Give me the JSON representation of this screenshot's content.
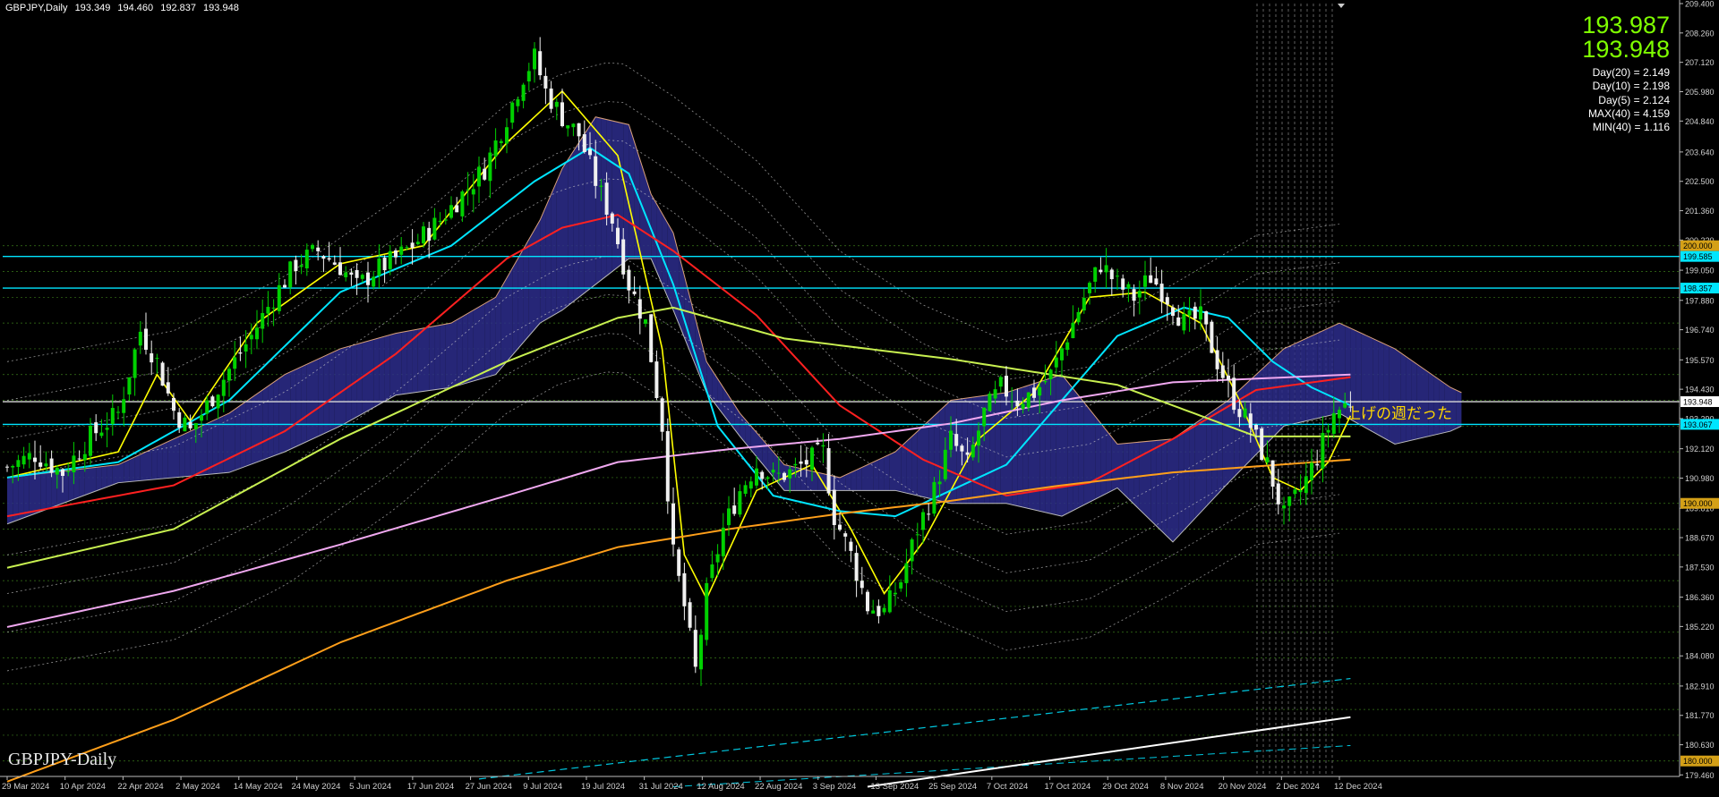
{
  "header": {
    "symbol": "GBPJPY,Daily",
    "open": "193.349",
    "high": "194.460",
    "low": "192.837",
    "close": "193.948"
  },
  "quote": {
    "ask": "193.987",
    "bid": "193.948"
  },
  "stats": [
    "Day(20) = 2.149",
    "Day(10) = 2.198",
    "Day(5) = 2.124",
    "MAX(40) = 4.159",
    "MIN(40) = 1.116"
  ],
  "watermark": "GBPJPY-Daily",
  "annotation": "上げの週だった",
  "colors": {
    "background": "#000000",
    "bull_candle": "#00d000",
    "bear_candle": "#f0f0f0",
    "ma_fast": "#ffff00",
    "ma_mid": "#00e5ff",
    "ma_slow": "#ff2020",
    "ma_long": "#c8f050",
    "ma_200": "#f0a8f0",
    "ma_longest": "#ff9f1a",
    "cloud_blue": "#2d2d8c",
    "cloud_red": "#b0503c",
    "hline_cyan": "#00e5ff",
    "quote_green": "#7fff00"
  },
  "chart_data": {
    "type": "candlestick",
    "symbol": "GBPJPY",
    "timeframe": "Daily",
    "ylim": [
      179.4,
      209.4
    ],
    "y_ticks": [
      "209.400",
      "208.260",
      "207.120",
      "205.980",
      "204.840",
      "203.640",
      "202.500",
      "201.360",
      "200.220",
      "199.050",
      "197.880",
      "196.740",
      "195.570",
      "194.430",
      "193.290",
      "192.120",
      "190.980",
      "189.810",
      "188.670",
      "187.530",
      "186.360",
      "185.220",
      "184.080",
      "182.910",
      "181.770",
      "180.630",
      "179.460"
    ],
    "x_ticks": [
      "29 Mar 2024",
      "10 Apr 2024",
      "22 Apr 2024",
      "2 May 2024",
      "14 May 2024",
      "24 May 2024",
      "5 Jun 2024",
      "17 Jun 2024",
      "27 Jun 2024",
      "9 Jul 2024",
      "19 Jul 2024",
      "31 Jul 2024",
      "12 Aug 2024",
      "22 Aug 2024",
      "3 Sep 2024",
      "13 Sep 2024",
      "25 Sep 2024",
      "7 Oct 2024",
      "17 Oct 2024",
      "29 Oct 2024",
      "8 Nov 2024",
      "20 Nov 2024",
      "2 Dec 2024",
      "12 Dec 2024"
    ],
    "price_labels": [
      {
        "value": 200.0,
        "text": "200.000",
        "color": "#d4a017"
      },
      {
        "value": 199.585,
        "text": "199.585",
        "color": "#00e5ff"
      },
      {
        "value": 198.357,
        "text": "198.357",
        "color": "#00e5ff"
      },
      {
        "value": 193.948,
        "text": "193.948",
        "color": "#ffffff"
      },
      {
        "value": 193.067,
        "text": "193.067",
        "color": "#00e5ff"
      },
      {
        "value": 190.0,
        "text": "190.000",
        "color": "#d4a017"
      },
      {
        "value": 180.0,
        "text": "180.000",
        "color": "#d4a017"
      }
    ],
    "close_path": [
      [
        0,
        191.4
      ],
      [
        5,
        191.9
      ],
      [
        10,
        191.2
      ],
      [
        15,
        192.6
      ],
      [
        20,
        193.5
      ],
      [
        24,
        196.7
      ],
      [
        27,
        195.5
      ],
      [
        30,
        193.6
      ],
      [
        33,
        192.8
      ],
      [
        36,
        193.8
      ],
      [
        40,
        195.2
      ],
      [
        44,
        196.5
      ],
      [
        48,
        198.0
      ],
      [
        52,
        199.3
      ],
      [
        56,
        199.8
      ],
      [
        60,
        199.2
      ],
      [
        63,
        198.4
      ],
      [
        66,
        199.0
      ],
      [
        70,
        199.5
      ],
      [
        74,
        200.2
      ],
      [
        78,
        201.0
      ],
      [
        82,
        202.0
      ],
      [
        86,
        203.0
      ],
      [
        90,
        205.0
      ],
      [
        93,
        206.6
      ],
      [
        95,
        207.3
      ],
      [
        97,
        206.0
      ],
      [
        100,
        205.0
      ],
      [
        103,
        204.3
      ],
      [
        106,
        202.5
      ],
      [
        109,
        201.0
      ],
      [
        112,
        198.5
      ],
      [
        115,
        197.0
      ],
      [
        118,
        193.0
      ],
      [
        120,
        188.0
      ],
      [
        122,
        186.0
      ],
      [
        124,
        183.5
      ],
      [
        126,
        186.5
      ],
      [
        129,
        189.0
      ],
      [
        132,
        190.5
      ],
      [
        135,
        191.5
      ],
      [
        138,
        191.0
      ],
      [
        141,
        191.2
      ],
      [
        144,
        191.6
      ],
      [
        147,
        192.0
      ],
      [
        149,
        189.5
      ],
      [
        152,
        188.0
      ],
      [
        155,
        186.0
      ],
      [
        158,
        185.8
      ],
      [
        161,
        187.0
      ],
      [
        164,
        189.0
      ],
      [
        167,
        190.5
      ],
      [
        170,
        192.5
      ],
      [
        173,
        191.5
      ],
      [
        176,
        193.5
      ],
      [
        179,
        194.5
      ],
      [
        182,
        194.0
      ],
      [
        185,
        194.3
      ],
      [
        188,
        195.0
      ],
      [
        191,
        196.5
      ],
      [
        194,
        198.0
      ],
      [
        197,
        199.3
      ],
      [
        200,
        198.5
      ],
      [
        203,
        198.0
      ],
      [
        206,
        198.8
      ],
      [
        209,
        198.0
      ],
      [
        212,
        197.0
      ],
      [
        215,
        197.2
      ],
      [
        218,
        195.5
      ],
      [
        221,
        194.0
      ],
      [
        224,
        193.0
      ],
      [
        227,
        191.5
      ],
      [
        230,
        189.5
      ],
      [
        233,
        190.5
      ],
      [
        236,
        191.8
      ],
      [
        239,
        193.5
      ],
      [
        242,
        193.948
      ]
    ],
    "series": [
      {
        "name": "MA fast",
        "color": "#ffff00",
        "points": [
          [
            0,
            191.0
          ],
          [
            20,
            192.0
          ],
          [
            27,
            195.0
          ],
          [
            33,
            193.2
          ],
          [
            45,
            197.0
          ],
          [
            60,
            199.3
          ],
          [
            75,
            200.0
          ],
          [
            90,
            204.0
          ],
          [
            100,
            206.0
          ],
          [
            110,
            203.5
          ],
          [
            118,
            196.0
          ],
          [
            122,
            188.0
          ],
          [
            126,
            186.3
          ],
          [
            135,
            190.5
          ],
          [
            145,
            191.5
          ],
          [
            152,
            189.0
          ],
          [
            158,
            186.5
          ],
          [
            165,
            188.5
          ],
          [
            175,
            192.5
          ],
          [
            185,
            194.3
          ],
          [
            195,
            198.0
          ],
          [
            205,
            198.2
          ],
          [
            215,
            197.0
          ],
          [
            222,
            194.0
          ],
          [
            228,
            191.0
          ],
          [
            233,
            190.5
          ],
          [
            238,
            191.6
          ],
          [
            242,
            193.4
          ]
        ]
      },
      {
        "name": "MA mid",
        "color": "#00e5ff",
        "points": [
          [
            0,
            191.0
          ],
          [
            20,
            191.6
          ],
          [
            40,
            194.0
          ],
          [
            60,
            198.2
          ],
          [
            80,
            200.0
          ],
          [
            95,
            202.5
          ],
          [
            105,
            203.8
          ],
          [
            112,
            202.8
          ],
          [
            120,
            198.5
          ],
          [
            128,
            193.0
          ],
          [
            138,
            190.3
          ],
          [
            150,
            189.7
          ],
          [
            160,
            189.5
          ],
          [
            170,
            190.5
          ],
          [
            180,
            191.5
          ],
          [
            190,
            194.0
          ],
          [
            200,
            196.5
          ],
          [
            212,
            197.6
          ],
          [
            220,
            197.2
          ],
          [
            228,
            195.5
          ],
          [
            235,
            194.5
          ],
          [
            242,
            193.8
          ]
        ]
      },
      {
        "name": "MA slow",
        "color": "#ff2020",
        "points": [
          [
            0,
            189.5
          ],
          [
            30,
            190.7
          ],
          [
            50,
            192.8
          ],
          [
            70,
            195.8
          ],
          [
            90,
            199.5
          ],
          [
            100,
            200.7
          ],
          [
            110,
            201.2
          ],
          [
            120,
            199.8
          ],
          [
            135,
            197.3
          ],
          [
            150,
            193.8
          ],
          [
            165,
            191.7
          ],
          [
            180,
            190.3
          ],
          [
            195,
            190.8
          ],
          [
            210,
            192.5
          ],
          [
            225,
            194.4
          ],
          [
            242,
            194.9
          ]
        ]
      },
      {
        "name": "MA long",
        "color": "#c8f050",
        "points": [
          [
            0,
            187.5
          ],
          [
            30,
            189.0
          ],
          [
            60,
            192.5
          ],
          [
            90,
            195.5
          ],
          [
            110,
            197.2
          ],
          [
            120,
            197.6
          ],
          [
            140,
            196.4
          ],
          [
            170,
            195.6
          ],
          [
            200,
            194.6
          ],
          [
            225,
            192.6
          ],
          [
            242,
            192.6
          ]
        ]
      },
      {
        "name": "MA 200",
        "color": "#f0a8f0",
        "points": [
          [
            0,
            185.2
          ],
          [
            30,
            186.6
          ],
          [
            60,
            188.4
          ],
          [
            90,
            190.3
          ],
          [
            110,
            191.6
          ],
          [
            130,
            192.1
          ],
          [
            150,
            192.5
          ],
          [
            170,
            193.1
          ],
          [
            190,
            194.0
          ],
          [
            210,
            194.7
          ],
          [
            242,
            195.0
          ]
        ]
      },
      {
        "name": "MA longest",
        "color": "#ff9f1a",
        "points": [
          [
            0,
            179.2
          ],
          [
            30,
            181.6
          ],
          [
            60,
            184.6
          ],
          [
            90,
            187.0
          ],
          [
            110,
            188.3
          ],
          [
            130,
            189.0
          ],
          [
            150,
            189.6
          ],
          [
            170,
            190.1
          ],
          [
            190,
            190.7
          ],
          [
            210,
            191.2
          ],
          [
            242,
            191.7
          ]
        ]
      }
    ],
    "cloud": [
      [
        0,
        191.0,
        189.2
      ],
      [
        20,
        191.5,
        190.8
      ],
      [
        40,
        193.5,
        191.2
      ],
      [
        50,
        195.0,
        192.0
      ],
      [
        60,
        196.0,
        193.0
      ],
      [
        70,
        196.6,
        194.2
      ],
      [
        80,
        197.0,
        194.5
      ],
      [
        88,
        198.0,
        195.0
      ],
      [
        96,
        201.0,
        197.0
      ],
      [
        100,
        203.0,
        197.5
      ],
      [
        106,
        205.0,
        198.5
      ],
      [
        112,
        204.7,
        199.5
      ],
      [
        116,
        202.0,
        199.5
      ],
      [
        120,
        200.5,
        197.5
      ],
      [
        126,
        195.5,
        194.3
      ],
      [
        132,
        193.5,
        192.6
      ],
      [
        140,
        191.5,
        190.5
      ],
      [
        150,
        191.0,
        190.5
      ],
      [
        160,
        192.0,
        190.5
      ],
      [
        170,
        194.0,
        190.0
      ],
      [
        180,
        194.3,
        190.0
      ],
      [
        190,
        195.0,
        189.5
      ],
      [
        200,
        192.3,
        190.6
      ],
      [
        210,
        192.5,
        188.5
      ],
      [
        220,
        194.0,
        190.8
      ],
      [
        230,
        196.0,
        193.0
      ],
      [
        240,
        197.0,
        193.5
      ],
      [
        250,
        196.0,
        192.3
      ],
      [
        260,
        194.5,
        192.8
      ],
      [
        262,
        194.3,
        193.0
      ]
    ],
    "hlines": [
      {
        "value": 199.585,
        "color": "#00e5ff"
      },
      {
        "value": 198.357,
        "color": "#00e5ff"
      },
      {
        "value": 193.067,
        "color": "#00e5ff"
      },
      {
        "value": 193.948,
        "color": "#d9d9d9"
      }
    ]
  }
}
